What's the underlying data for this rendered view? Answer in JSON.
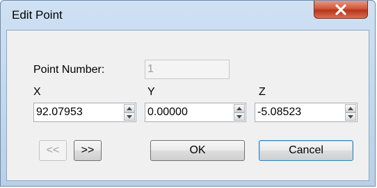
{
  "window": {
    "title": "Edit Point"
  },
  "point_number": {
    "label": "Point Number:",
    "value": "1"
  },
  "coords": {
    "x_label": "X",
    "x_value": "92.07953",
    "y_label": "Y",
    "y_value": "0.00000",
    "z_label": "Z",
    "z_value": "-5.08523"
  },
  "buttons": {
    "prev": "<<",
    "next": ">>",
    "ok": "OK",
    "cancel": "Cancel"
  },
  "colors": {
    "close_button": "#c9452a",
    "default_border": "#3c7fb1"
  },
  "icons": {
    "close": "close-icon",
    "spin_up": "spin-up-icon",
    "spin_down": "spin-down-icon"
  }
}
